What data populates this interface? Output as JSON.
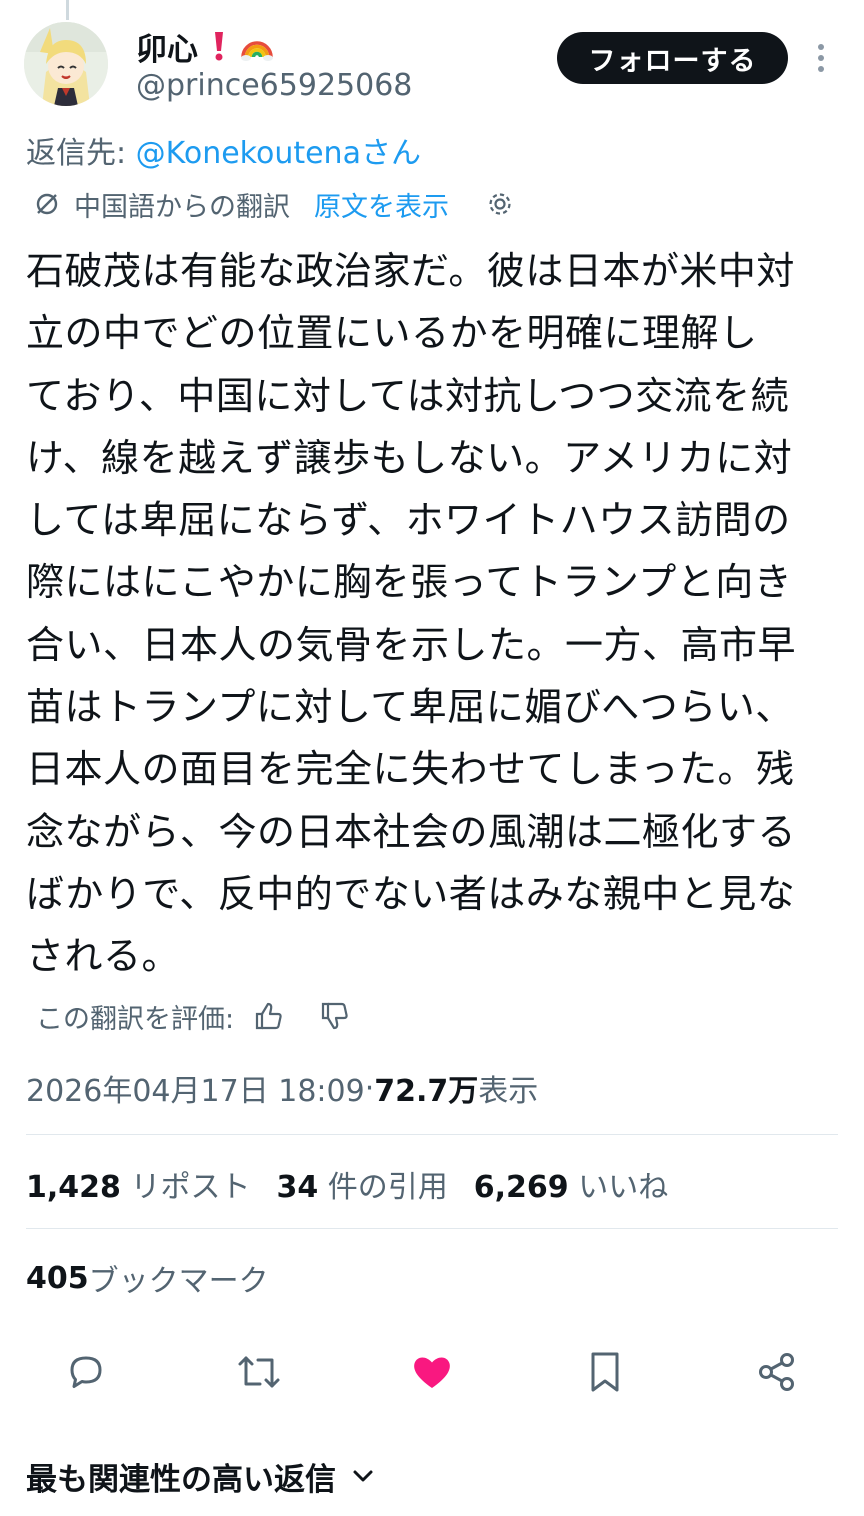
{
  "colors": {
    "text": "#0f1419",
    "secondary": "#536471",
    "accent": "#1d9bf0",
    "like": "#f91880",
    "follow_bg": "#0f1419"
  },
  "author": {
    "display_name": "卯心",
    "emojis": [
      "red-exclamation-icon",
      "rainbow-icon"
    ],
    "handle": "@prince65925068",
    "follow_label": "フォローする"
  },
  "reply": {
    "prefix": "返信先: ",
    "mention": "@Konekoutena",
    "suffix": "さん"
  },
  "translation": {
    "note": "中国語からの翻訳",
    "show_original": "原文を表示",
    "rate_label": "この翻訳を評価:"
  },
  "tweet": {
    "text": "石破茂は有能な政治家だ。彼は日本が米中対\n立の中でどの位置にいるかを明確に理解し\nており、中国に対しては対抗しつつ交流を続\nけ、線を越えず譲歩もしない。アメリカに対\nしては卑屈にならず、ホワイトハウス訪問の\n際にはにこやかに胸を張ってトランプと向き\n合い、日本人の気骨を示した。一方、高市早\n苗はトランプに対して卑屈に媚びへつらい、\n日本人の面目を完全に失わせてしまった。残\n念ながら、今の日本社会の風潮は二極化する\nばかりで、反中的でない者はみな親中と見な\nされる。"
  },
  "meta": {
    "timestamp": "2026年04月17日 18:09",
    "separator": " · ",
    "views_count": "72.7万",
    "views_label": " 表示"
  },
  "stats": {
    "reposts_count": "1,428",
    "reposts_label": " リポスト",
    "quotes_count": "34",
    "quotes_label": " 件の引用",
    "likes_count": "6,269",
    "likes_label": " いいね",
    "bookmarks_count": "405",
    "bookmarks_label": " ブックマーク"
  },
  "replies_sort": {
    "label": "最も関連性の高い返信"
  }
}
